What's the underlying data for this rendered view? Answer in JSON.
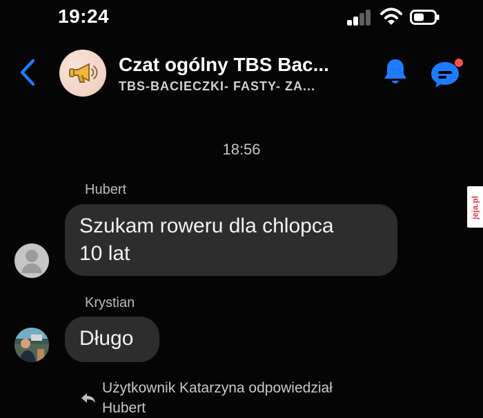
{
  "status_bar": {
    "time": "19:24",
    "icons": [
      "signal-icon",
      "wifi-icon",
      "battery-icon"
    ]
  },
  "header": {
    "title": "Czat ogólny TBS Bac...",
    "subtitle": "TBS-BACIECZKI- FASTY- ZA...",
    "icons": {
      "back": "chevron-left-icon",
      "group": "megaphone-icon",
      "bell": "bell-icon",
      "chat": "chat-notification-icon"
    },
    "colors": {
      "accent": "#1e7bff",
      "notification_dot": "#ff4d4f"
    }
  },
  "chat": {
    "timestamp": "18:56",
    "messages": [
      {
        "sender": "Hubert",
        "text": "Szukam roweru dla chlopca\n10 lat",
        "avatar_icon": "default-avatar-icon"
      },
      {
        "sender": "Krystian",
        "text": "Długo",
        "avatar_icon": "user-photo-icon"
      }
    ],
    "reply_notice": "Użytkownik Katarzyna odpowiedział\nHubert",
    "reply_icon": "reply-icon"
  },
  "watermark": {
    "text": "jeja.pl"
  }
}
